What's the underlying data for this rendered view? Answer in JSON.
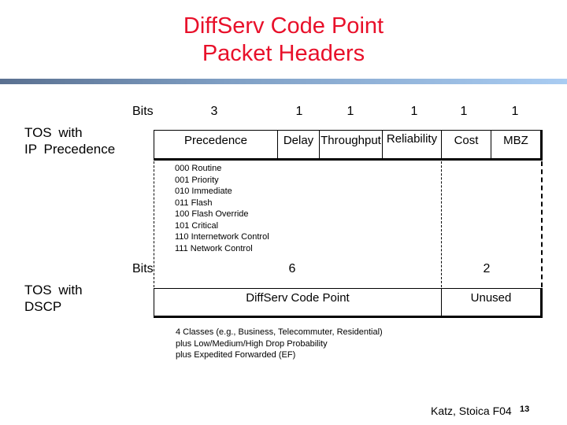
{
  "title": [
    "DiffServ Code Point",
    "Packet Headers"
  ],
  "tos_ip": {
    "label": [
      "TOS with",
      "IP Precedence"
    ],
    "bits_label": "Bits",
    "fields": [
      {
        "name": "Precedence",
        "bits": "3"
      },
      {
        "name": "Delay",
        "bits": "1"
      },
      {
        "name": "Throughput",
        "bits": "1"
      },
      {
        "name": "Reliability",
        "bits": "1"
      },
      {
        "name": "Cost",
        "bits": "1"
      },
      {
        "name": "MBZ",
        "bits": "1"
      }
    ],
    "precedence_values": [
      "000 Routine",
      "001 Priority",
      "010 Immediate",
      "011 Flash",
      "100 Flash Override",
      "101 Critical",
      "110 Internetwork Control",
      "111 Network Control"
    ]
  },
  "tos_dscp": {
    "label": [
      "TOS with",
      "DSCP"
    ],
    "bits_label": "Bits",
    "fields": [
      {
        "name": "DiffServ Code Point",
        "bits": "6"
      },
      {
        "name": "Unused",
        "bits": "2"
      }
    ],
    "notes": [
      "4 Classes (e.g., Business, Telecommuter, Residential)",
      "plus Low/Medium/High Drop Probability",
      "plus Expedited Forwarded (EF)"
    ]
  },
  "footer": {
    "credit": "Katz, Stoica F04",
    "page": "13"
  },
  "colors": {
    "title": "#e8102a"
  }
}
